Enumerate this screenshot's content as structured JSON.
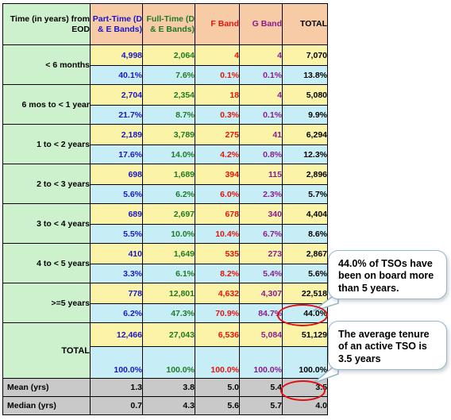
{
  "table": {
    "headers": [
      {
        "label": "Time (in years) from EOD",
        "name": "col-time"
      },
      {
        "label": "Part-Time (D & E Bands)",
        "name": "col-part-time"
      },
      {
        "label": "Full-Time (D & E Bands)",
        "name": "col-full-time"
      },
      {
        "label": "F Band",
        "name": "col-f-band"
      },
      {
        "label": "G Band",
        "name": "col-g-band"
      },
      {
        "label": "TOTAL",
        "name": "col-total"
      }
    ],
    "rows": [
      {
        "label": "< 6 months",
        "counts": [
          "4,998",
          "2,064",
          "4",
          "4",
          "7,070"
        ],
        "percents": [
          "40.1%",
          "7.6%",
          "0.1%",
          "0.1%",
          "13.8%"
        ]
      },
      {
        "label": "6 mos to < 1 year",
        "counts": [
          "2,704",
          "2,354",
          "18",
          "4",
          "5,080"
        ],
        "percents": [
          "21.7%",
          "8.7%",
          "0.3%",
          "0.1%",
          "9.9%"
        ]
      },
      {
        "label": "1 to < 2 years",
        "counts": [
          "2,189",
          "3,789",
          "275",
          "41",
          "6,294"
        ],
        "percents": [
          "17.6%",
          "14.0%",
          "4.2%",
          "0.8%",
          "12.3%"
        ]
      },
      {
        "label": "2 to < 3 years",
        "counts": [
          "698",
          "1,689",
          "394",
          "115",
          "2,896"
        ],
        "percents": [
          "5.6%",
          "6.2%",
          "6.0%",
          "2.3%",
          "5.7%"
        ]
      },
      {
        "label": "3 to < 4 years",
        "counts": [
          "689",
          "2,697",
          "678",
          "340",
          "4,404"
        ],
        "percents": [
          "5.5%",
          "10.0%",
          "10.4%",
          "6.7%",
          "8.6%"
        ]
      },
      {
        "label": "4 to < 5 years",
        "counts": [
          "410",
          "1,649",
          "535",
          "273",
          "2,867"
        ],
        "percents": [
          "3.3%",
          "6.1%",
          "8.2%",
          "5.4%",
          "5.6%"
        ]
      },
      {
        "label": ">=5 years",
        "counts": [
          "778",
          "12,801",
          "4,632",
          "4,307",
          "22,518"
        ],
        "percents": [
          "6.2%",
          "47.3%",
          "70.9%",
          "84.7%",
          "44.0%"
        ]
      }
    ],
    "total_row": {
      "label": "TOTAL",
      "counts": [
        "12,466",
        "27,043",
        "6,536",
        "5,084",
        "51,129"
      ],
      "percents": [
        "100.0%",
        "100.0%",
        "100.0%",
        "100.0%",
        "100.0%"
      ]
    },
    "stats_rows": [
      {
        "label": "Mean (yrs)",
        "values": [
          "1.3",
          "3.8",
          "5.0",
          "5.4",
          "3.5"
        ]
      },
      {
        "label": "Median (yrs)",
        "values": [
          "0.7",
          "4.3",
          "5.6",
          "5.7",
          "4.0"
        ]
      }
    ]
  },
  "callouts": [
    {
      "text": "44.0% of TSOs have been on board more than 5 years.",
      "name": "callout-five-years"
    },
    {
      "text": "The average tenure of an active TSO is 3.5 years",
      "name": "callout-average-tenure"
    }
  ],
  "highlights": [
    {
      "name": "highlight-44-percent",
      "value": "44.0%"
    },
    {
      "name": "highlight-mean-total",
      "value": "3.5"
    }
  ],
  "colors": {
    "header_bg": "#f6cba6",
    "label_bg": "#cdf0cd",
    "count_bg": "#fbf4a8",
    "percent_bg": "#c7eef7",
    "stats_bg": "#c9c9c9",
    "part_time": "#1a16c8",
    "full_time": "#1f7a24",
    "f_band": "#e8130a",
    "g_band": "#8b1a8f",
    "total": "#000000",
    "annotation_red": "#e01010",
    "callout_border": "#93b7cc"
  }
}
